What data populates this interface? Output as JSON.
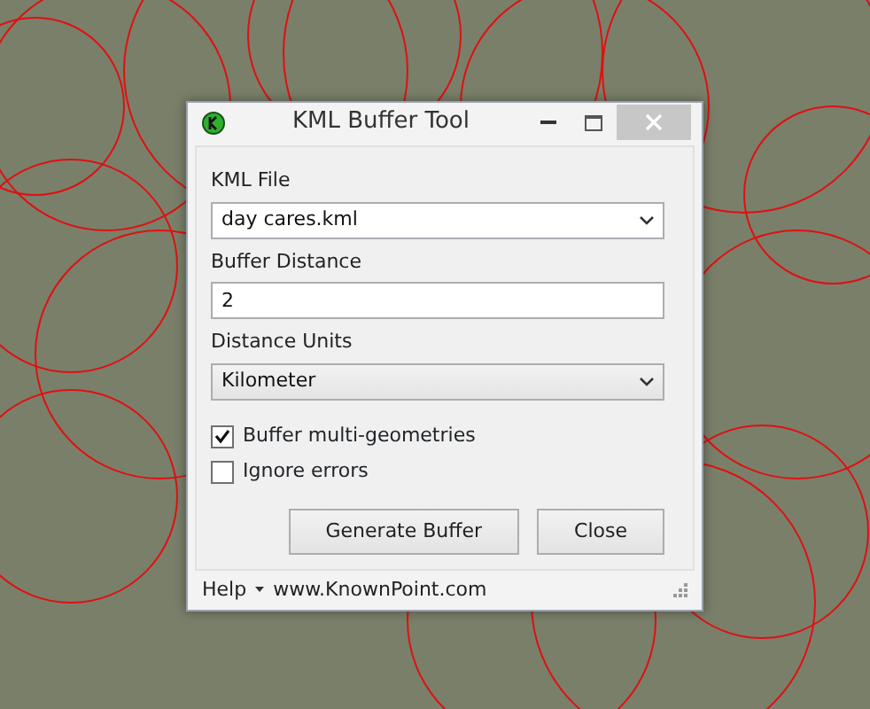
{
  "window": {
    "title": "KML Buffer Tool"
  },
  "fields": [
    {
      "kind": "combo",
      "label": "KML File",
      "value": "day cares.kml"
    },
    {
      "kind": "text",
      "label": "Buffer Distance",
      "value": "2"
    },
    {
      "kind": "list",
      "label": "Distance Units",
      "value": "Kilometer"
    }
  ],
  "options": [
    {
      "label": "Buffer multi-geometries",
      "checked": true
    },
    {
      "label": "Ignore errors",
      "checked": false
    }
  ],
  "buttons": [
    "Generate Buffer",
    "Close"
  ],
  "status_bar": {
    "help": "Help",
    "link": "www.KnownPoint.com"
  }
}
